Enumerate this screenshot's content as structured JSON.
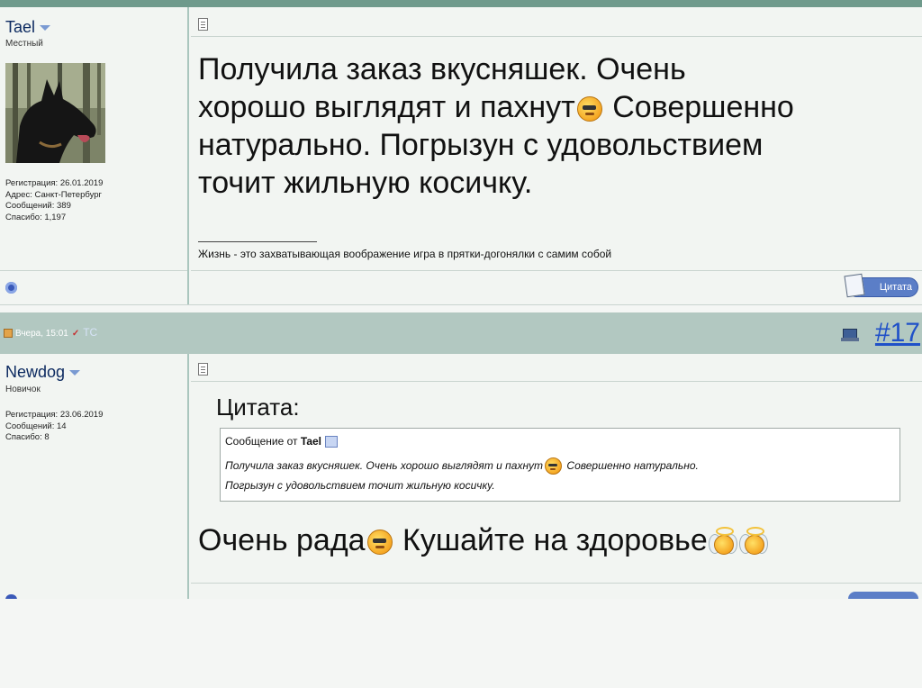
{
  "post1": {
    "user": {
      "name": "Tael",
      "title": "Местный",
      "info": [
        "Регистрация: 26.01.2019",
        "Адрес: Санкт-Петербург",
        "Сообщений: 389",
        "Спасибо: 1,197"
      ]
    },
    "message": {
      "line1": "Получила заказ вкусняшек. Очень",
      "line2a": "хорошо выглядят и пахнут",
      "line2b": " Совершенно",
      "line3": "натурально. Погрызун с удовольствием",
      "line4": "точит жильную косичку."
    },
    "signature": "Жизнь - это захватывающая воображение игра в прятки-догонялки с самим собой",
    "quote_button": "Цитата"
  },
  "post2": {
    "date": "Вчера, 15:01",
    "tag": "ТС",
    "number": "#17",
    "user": {
      "name": "Newdog",
      "title": "Новичок",
      "info": [
        "Регистрация: 23.06.2019",
        "Сообщений: 14",
        "Спасибо: 8"
      ]
    },
    "quote": {
      "label": "Цитата:",
      "from_prefix": "Сообщение от",
      "from_name": "Tael",
      "text_a": "Получила заказ вкусняшек. Очень хорошо выглядят и пахнут",
      "text_b": " Совершенно натурально.",
      "text_c": "Погрызун с удовольствием точит жильную косичку."
    },
    "reply": {
      "part1": "Очень рада",
      "part2": "  Кушайте на здоровье"
    }
  },
  "icons": {
    "smile": "smile-icon",
    "angel": "angel-icon",
    "online": "online-status-icon",
    "post": "post-icon",
    "quote": "quote-pencil-icon",
    "computer": "computer-icon",
    "view_post": "view-post-icon"
  },
  "colors": {
    "header_bar": "#b2c8c1",
    "top_bar": "#6f9a8c",
    "link_blue": "#1f50c8",
    "button_blue": "#5b7ec7"
  }
}
